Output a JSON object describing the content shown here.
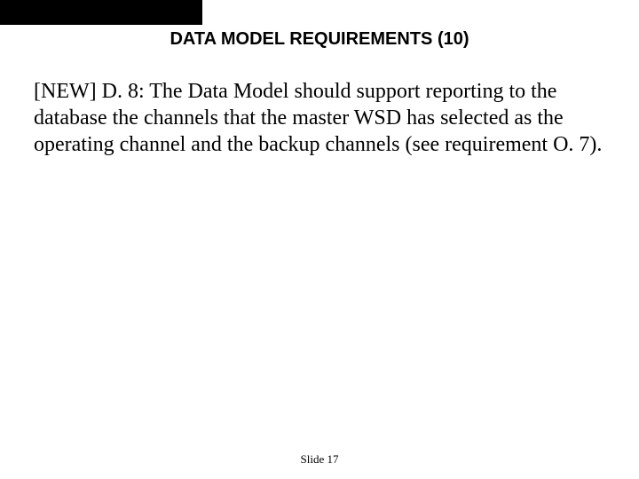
{
  "slide": {
    "title": "DATA MODEL REQUIREMENTS (10)",
    "body": "[NEW] D. 8: The Data Model should support reporting to the database the channels that the master WSD has selected as the operating channel and the backup channels (see requirement O. 7).",
    "footer": "Slide 17"
  }
}
